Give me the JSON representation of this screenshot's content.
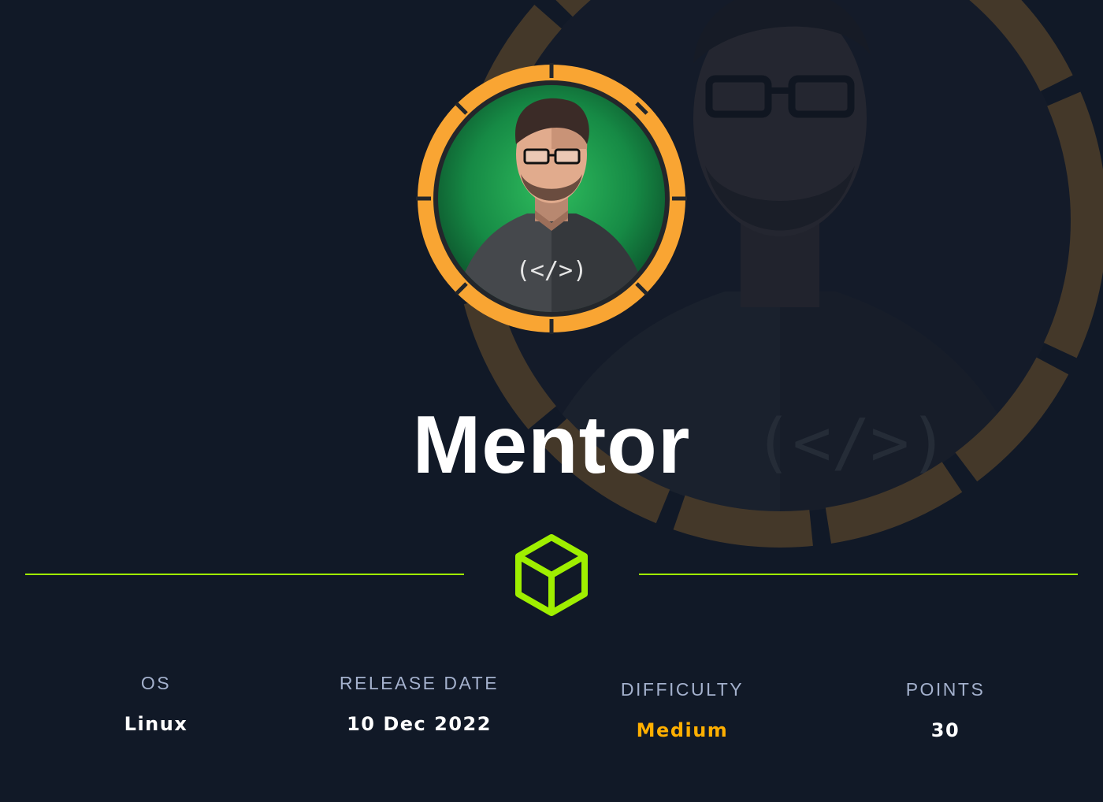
{
  "machine": {
    "name": "Mentor",
    "shirt_code": "(</>)"
  },
  "stats": {
    "os": {
      "label": "OS",
      "value": "Linux"
    },
    "release_date": {
      "label": "RELEASE DATE",
      "value": "10 Dec 2022"
    },
    "difficulty": {
      "label": "DIFFICULTY",
      "value": "Medium"
    },
    "points": {
      "label": "POINTS",
      "value": "30"
    }
  },
  "colors": {
    "background": "#111927",
    "accent_green": "#9fef00",
    "ring_orange": "#f9a533",
    "difficulty_medium": "#ffaf00",
    "label_gray": "#a4b1cd",
    "value_white": "#ffffff"
  },
  "icons": {
    "avatar": "mentor-avatar",
    "divider": "cube-icon"
  }
}
